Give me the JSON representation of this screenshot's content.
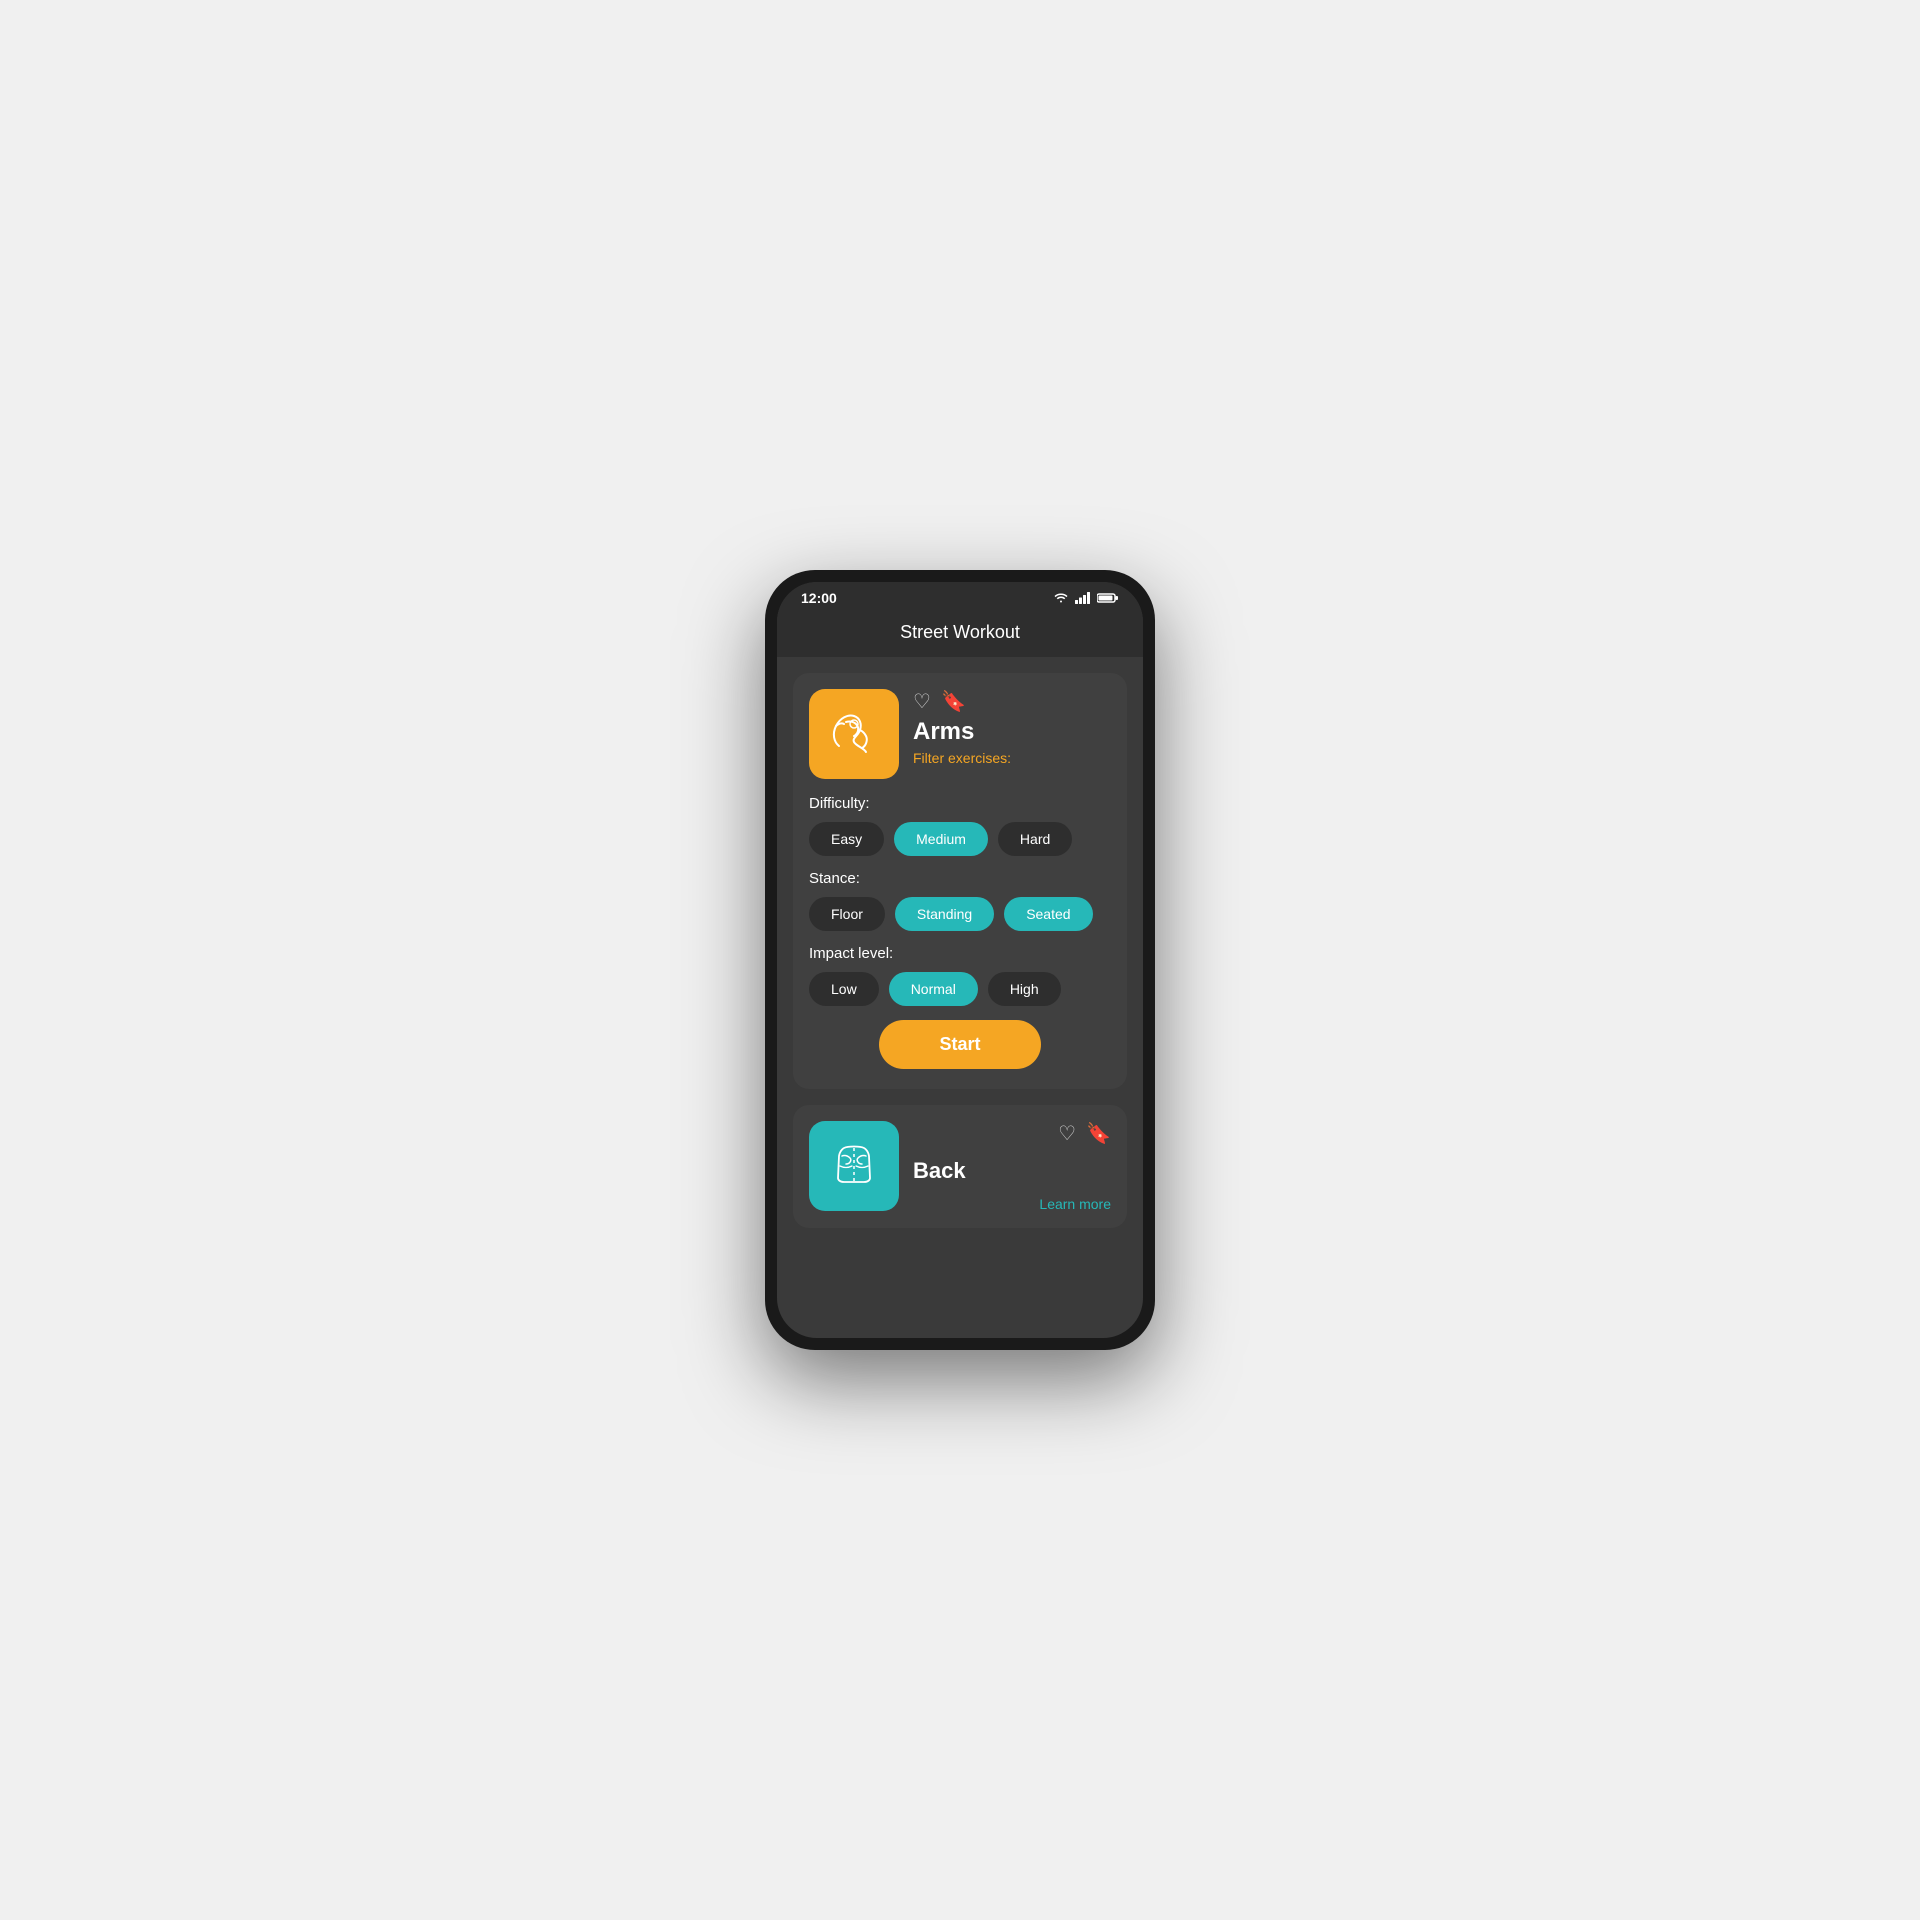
{
  "statusBar": {
    "time": "12:00",
    "wifi": "wifi",
    "signal": "signal",
    "battery": "battery"
  },
  "appTitle": "Street Workout",
  "card1": {
    "name": "Arms",
    "filterLabel": "Filter exercises:",
    "difficulty": {
      "label": "Difficulty:",
      "options": [
        {
          "id": "easy",
          "label": "Easy",
          "active": false
        },
        {
          "id": "medium",
          "label": "Medium",
          "active": true
        },
        {
          "id": "hard",
          "label": "Hard",
          "active": false
        }
      ]
    },
    "stance": {
      "label": "Stance:",
      "options": [
        {
          "id": "floor",
          "label": "Floor",
          "active": false
        },
        {
          "id": "standing",
          "label": "Standing",
          "active": true
        },
        {
          "id": "seated",
          "label": "Seated",
          "active": true
        }
      ]
    },
    "impactLevel": {
      "label": "Impact level:",
      "options": [
        {
          "id": "low",
          "label": "Low",
          "active": false
        },
        {
          "id": "normal",
          "label": "Normal",
          "active": true
        },
        {
          "id": "high",
          "label": "High",
          "active": false
        }
      ]
    },
    "startButton": "Start"
  },
  "card2": {
    "name": "Back",
    "learnMore": "Learn more"
  }
}
